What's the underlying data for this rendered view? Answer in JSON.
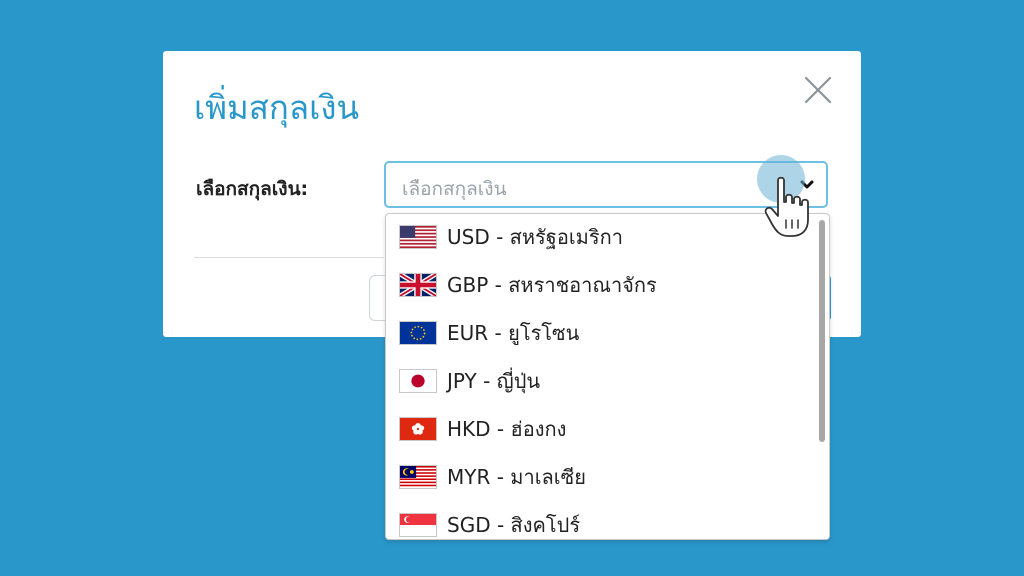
{
  "modal": {
    "title": "เพิ่มสกุลเงิน",
    "field_label": "เลือกสกุลเงิน:",
    "select_placeholder": "เลือกสกุลเงิน"
  },
  "currency_options": [
    {
      "label": "USD - สหรัฐอเมริกา",
      "flag": "us-flag-icon"
    },
    {
      "label": "GBP - สหราชอาณาจักร",
      "flag": "uk-flag-icon"
    },
    {
      "label": "EUR - ยูโรโซน",
      "flag": "eu-flag-icon"
    },
    {
      "label": "JPY - ญี่ปุ่น",
      "flag": "jp-flag-icon"
    },
    {
      "label": "HKD - ฮ่องกง",
      "flag": "hk-flag-icon"
    },
    {
      "label": "MYR - มาเลเซีย",
      "flag": "my-flag-icon"
    },
    {
      "label": "SGD - สิงคโปร์",
      "flag": "sg-flag-icon"
    }
  ],
  "colors": {
    "background": "#2a97cb",
    "accent": "#2a97cb",
    "select_border": "#6cc0e3"
  }
}
